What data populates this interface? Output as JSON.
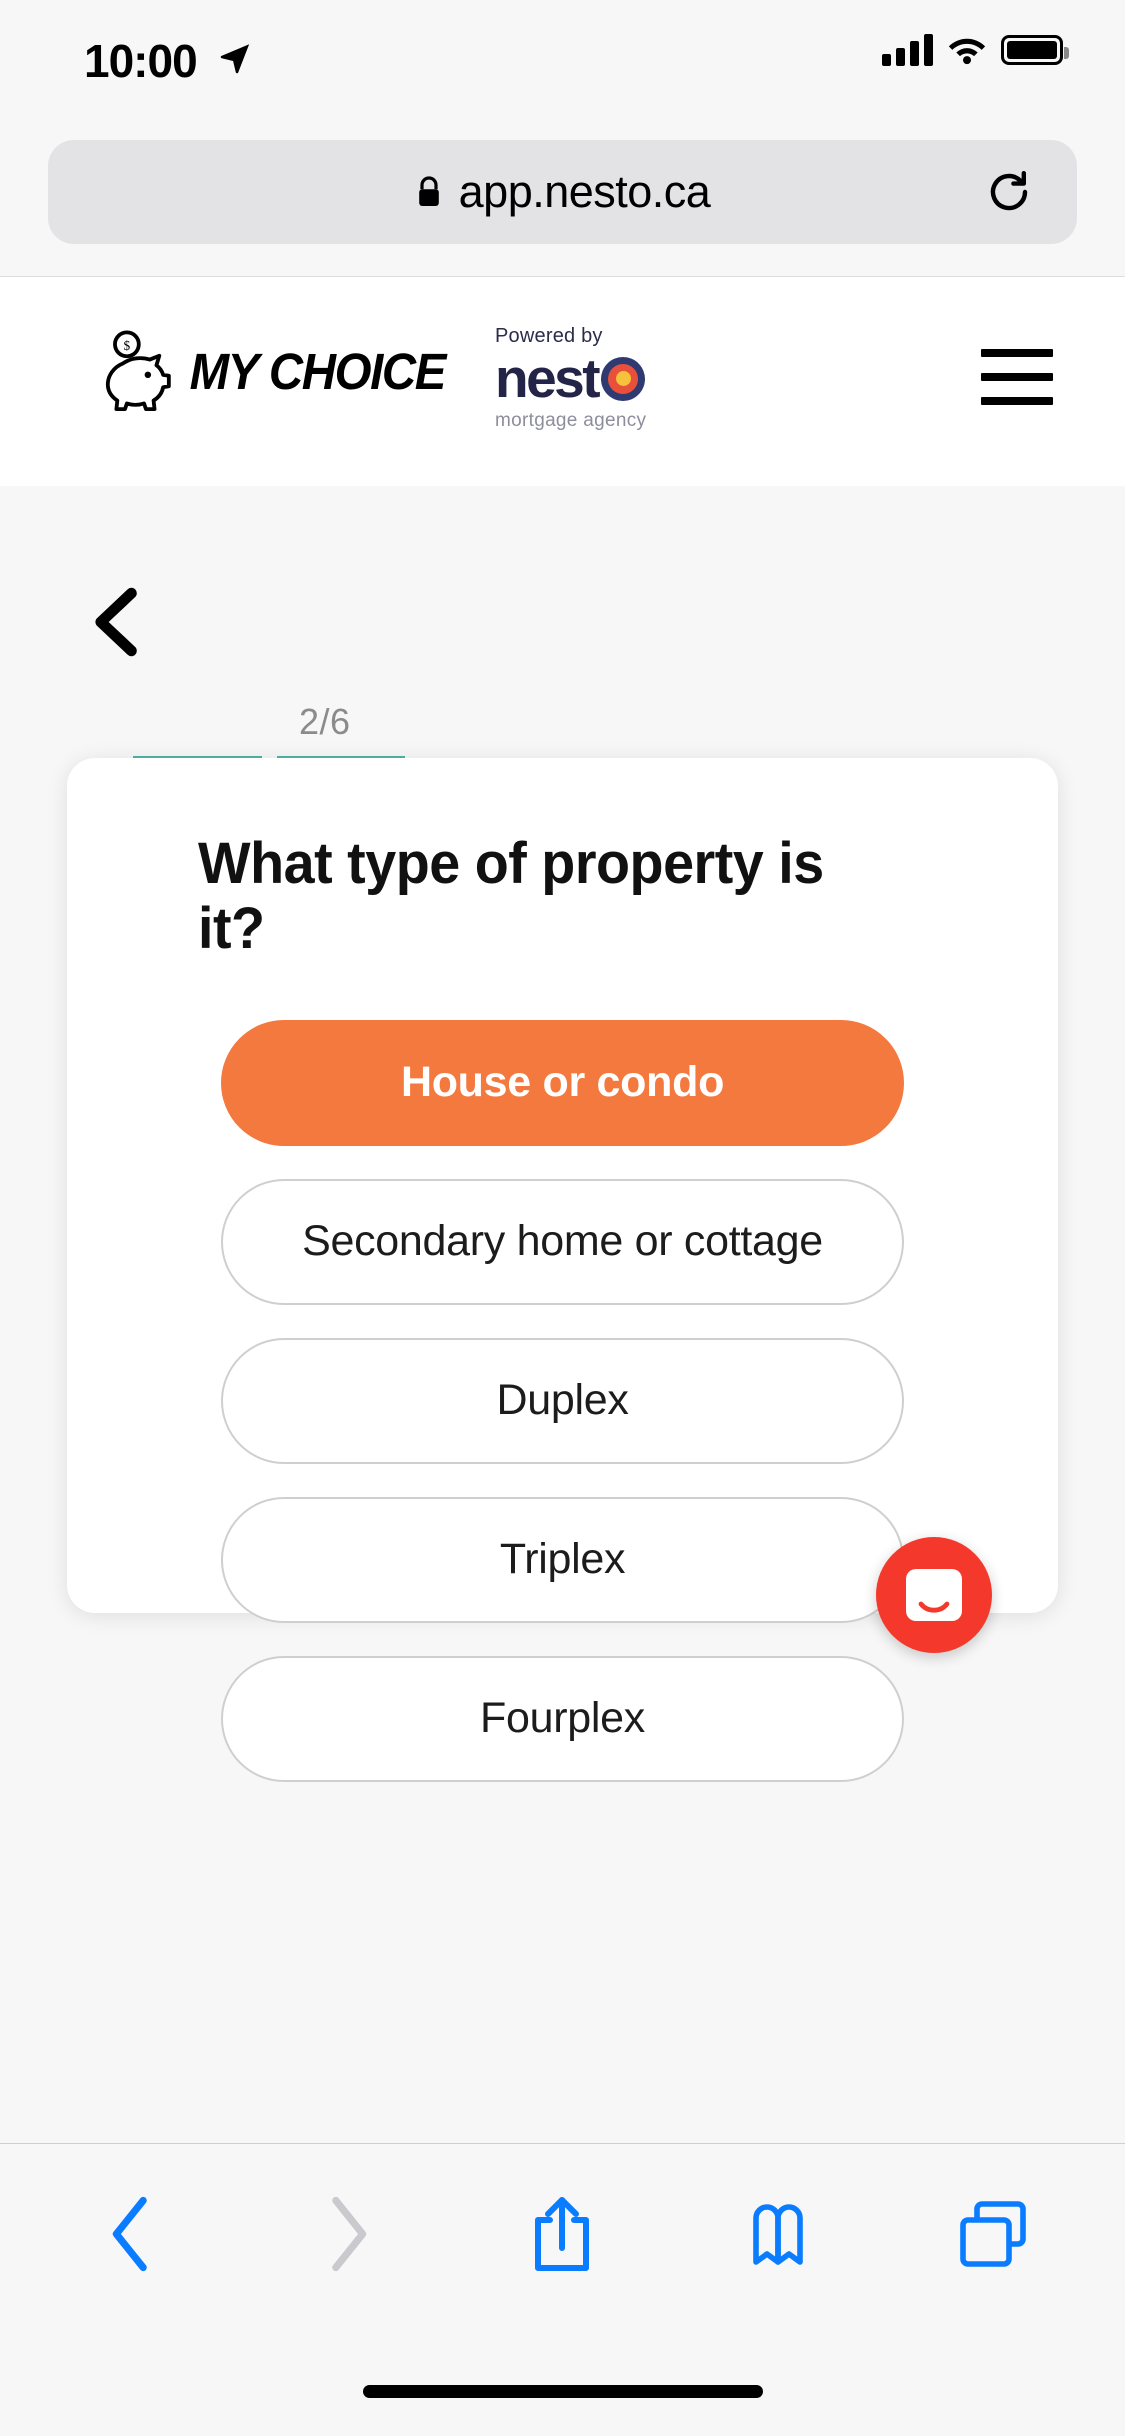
{
  "status_bar": {
    "time": "10:00",
    "location_icon": "location-arrow-icon",
    "cellular_icon": "cellular-bars-icon",
    "wifi_icon": "wifi-icon",
    "battery_icon": "battery-full-icon"
  },
  "browser": {
    "url": "app.nesto.ca",
    "lock_icon": "lock-icon",
    "reload_icon": "reload-icon",
    "toolbar": {
      "back_label": "back-icon",
      "forward_label": "forward-icon",
      "share_label": "share-icon",
      "bookmarks_label": "bookmarks-icon",
      "tabs_label": "tabs-icon"
    }
  },
  "site_header": {
    "brand_name": "MY CHOICE",
    "piggy_icon": "piggy-bank-icon",
    "partner": {
      "powered_by": "Powered by",
      "name": "nest",
      "tagline": "mortgage agency"
    },
    "menu_icon": "hamburger-menu-icon"
  },
  "page": {
    "back_icon": "chevron-left-icon",
    "progress": {
      "label": "2/6",
      "current": 2,
      "total": 6,
      "segments_filled": 2,
      "color": "#4fb3a4"
    },
    "question": "What type of property is it?",
    "options": [
      {
        "label": "House or condo",
        "selected": true
      },
      {
        "label": "Secondary home or cottage",
        "selected": false
      },
      {
        "label": "Duplex",
        "selected": false
      },
      {
        "label": "Triplex",
        "selected": false
      },
      {
        "label": "Fourplex",
        "selected": false
      }
    ]
  },
  "chat_widget": {
    "icon": "intercom-chat-icon",
    "color": "#f4392c"
  },
  "colors": {
    "accent_orange": "#f4793f",
    "progress_teal": "#4fb3a4",
    "chat_red": "#f4392c",
    "nesto_navy": "#232447",
    "toolbar_blue": "#0a7cff"
  }
}
